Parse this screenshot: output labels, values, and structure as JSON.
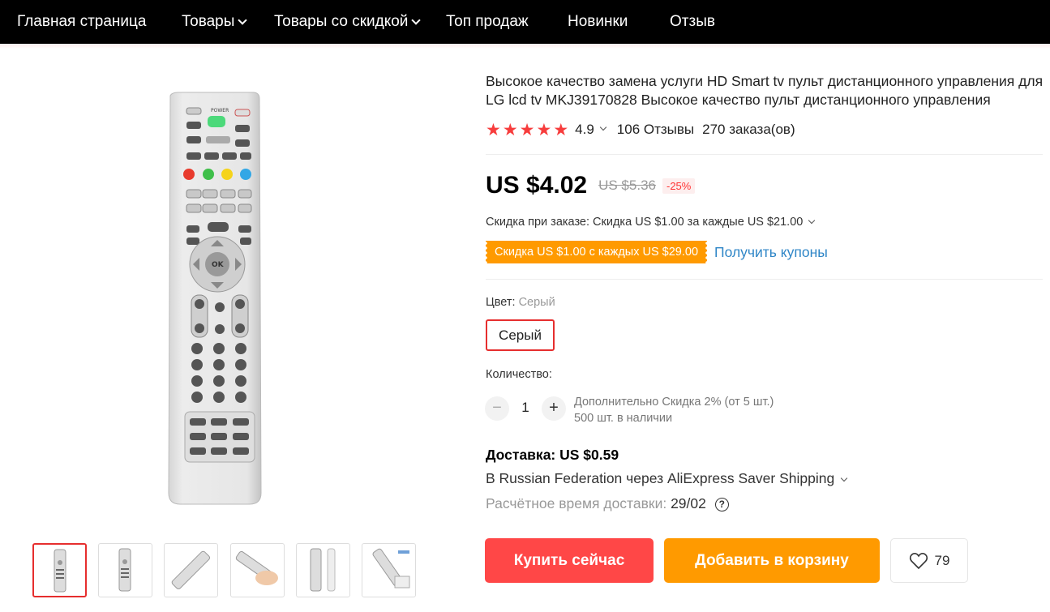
{
  "nav": {
    "items": [
      {
        "label": "Главная страница",
        "dropdown": false
      },
      {
        "label": "Товары",
        "dropdown": true
      },
      {
        "label": "Товары со скидкой",
        "dropdown": true
      },
      {
        "label": "Топ продаж",
        "dropdown": false
      },
      {
        "label": "Новинки",
        "dropdown": false
      },
      {
        "label": "Отзыв",
        "dropdown": false
      }
    ]
  },
  "gallery": {
    "thumbnail_count": 6,
    "selected_index": 0,
    "thumbnail_icons": [
      "remote-front-icon",
      "remote-front-icon",
      "remote-angled-icon",
      "remote-in-hand-icon",
      "remote-front-side-icon",
      "remote-package-icon"
    ]
  },
  "product": {
    "title": "Высокое качество замена услуги HD Smart tv пульт дистанционного управления для LG lcd tv MKJ39170828 Высокое качество пульт дистанционного управления",
    "rating": "4.9",
    "stars": 5,
    "reviews": "106 Отзывы",
    "orders": "270 заказа(ов)"
  },
  "price": {
    "current": "US $4.02",
    "old": "US $5.36",
    "discount": "-25%"
  },
  "promo": {
    "order_discount": "Скидка при заказе: Скидка US $1.00 за каждые US $21.00",
    "coupon_tag": "Скидка US $1.00 с каждых US $29.00",
    "coupon_link": "Получить купоны"
  },
  "color": {
    "label": "Цвет:",
    "selected": "Серый",
    "options": [
      "Серый"
    ]
  },
  "quantity": {
    "label": "Количество:",
    "value": "1",
    "minus": "−",
    "plus": "+",
    "extra_discount": "Дополнительно Скидка 2% (от 5 шт.)",
    "stock": "500 шт. в наличии"
  },
  "shipping": {
    "title": "Доставка: US $0.59",
    "via": "В Russian Federation через AliExpress Saver Shipping",
    "time_label": "Расчётное время доставки:",
    "date": "29/02",
    "help": "?"
  },
  "actions": {
    "buy_now": "Купить сейчас",
    "add_to_cart": "Добавить в корзину",
    "wishlist_count": "79"
  },
  "colors": {
    "nav_bg": "#000000",
    "accent_red": "#ff4747",
    "accent_orange": "#ff9a00",
    "star": "#f73d3d",
    "link": "#2f86c7"
  }
}
